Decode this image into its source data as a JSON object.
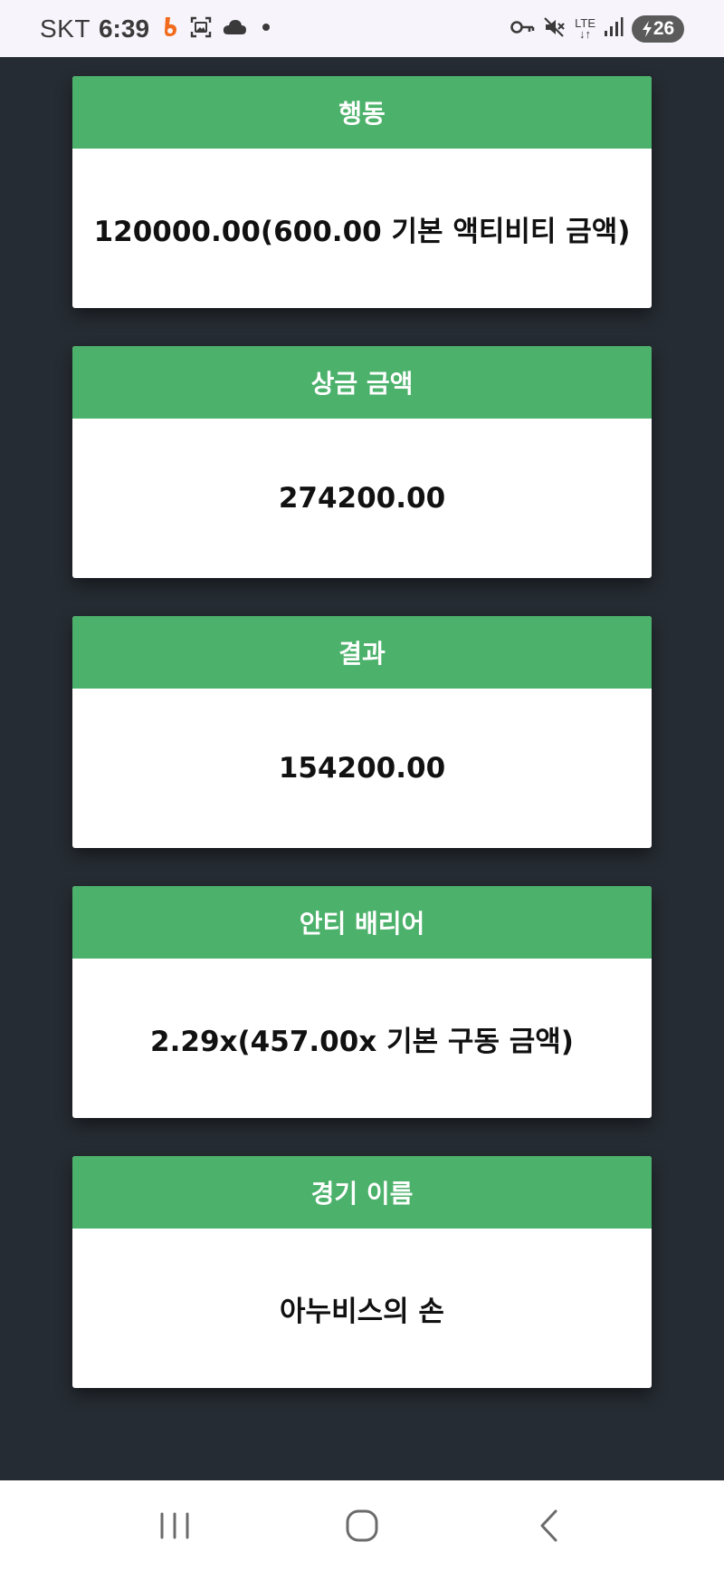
{
  "status_bar": {
    "carrier": "SKT",
    "time": "6:39",
    "network_label": "LTE",
    "battery_level": "26",
    "icons": [
      "app-notification-icon",
      "screenshot-icon",
      "cloud-icon",
      "dot-icon",
      "vpn-key-icon",
      "mute-icon",
      "lte-icon",
      "signal-icon",
      "battery-charging-icon"
    ]
  },
  "cards": [
    {
      "title": "행동",
      "value": "120000.00(600.00 기본 액티비티 금액)"
    },
    {
      "title": "상금 금액",
      "value": "274200.00"
    },
    {
      "title": "결과",
      "value": "154200.00"
    },
    {
      "title": "안티 배리어",
      "value": "2.29x(457.00x 기본 구동 금액)"
    },
    {
      "title": "경기 이름",
      "value": "아누비스의 손"
    }
  ],
  "nav_bar": {
    "buttons": [
      "recent-apps",
      "home",
      "back"
    ]
  },
  "colors": {
    "background": "#262c33",
    "card_header": "#4cb16b",
    "card_body": "#ffffff",
    "status_bar": "#f7f4fb"
  }
}
